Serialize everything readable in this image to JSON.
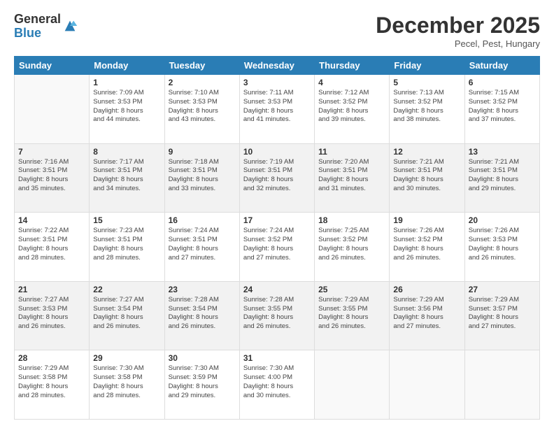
{
  "logo": {
    "general": "General",
    "blue": "Blue"
  },
  "title": "December 2025",
  "subtitle": "Pecel, Pest, Hungary",
  "headers": [
    "Sunday",
    "Monday",
    "Tuesday",
    "Wednesday",
    "Thursday",
    "Friday",
    "Saturday"
  ],
  "weeks": [
    [
      {
        "day": "",
        "info": ""
      },
      {
        "day": "1",
        "info": "Sunrise: 7:09 AM\nSunset: 3:53 PM\nDaylight: 8 hours\nand 44 minutes."
      },
      {
        "day": "2",
        "info": "Sunrise: 7:10 AM\nSunset: 3:53 PM\nDaylight: 8 hours\nand 43 minutes."
      },
      {
        "day": "3",
        "info": "Sunrise: 7:11 AM\nSunset: 3:53 PM\nDaylight: 8 hours\nand 41 minutes."
      },
      {
        "day": "4",
        "info": "Sunrise: 7:12 AM\nSunset: 3:52 PM\nDaylight: 8 hours\nand 39 minutes."
      },
      {
        "day": "5",
        "info": "Sunrise: 7:13 AM\nSunset: 3:52 PM\nDaylight: 8 hours\nand 38 minutes."
      },
      {
        "day": "6",
        "info": "Sunrise: 7:15 AM\nSunset: 3:52 PM\nDaylight: 8 hours\nand 37 minutes."
      }
    ],
    [
      {
        "day": "7",
        "info": "Sunrise: 7:16 AM\nSunset: 3:51 PM\nDaylight: 8 hours\nand 35 minutes."
      },
      {
        "day": "8",
        "info": "Sunrise: 7:17 AM\nSunset: 3:51 PM\nDaylight: 8 hours\nand 34 minutes."
      },
      {
        "day": "9",
        "info": "Sunrise: 7:18 AM\nSunset: 3:51 PM\nDaylight: 8 hours\nand 33 minutes."
      },
      {
        "day": "10",
        "info": "Sunrise: 7:19 AM\nSunset: 3:51 PM\nDaylight: 8 hours\nand 32 minutes."
      },
      {
        "day": "11",
        "info": "Sunrise: 7:20 AM\nSunset: 3:51 PM\nDaylight: 8 hours\nand 31 minutes."
      },
      {
        "day": "12",
        "info": "Sunrise: 7:21 AM\nSunset: 3:51 PM\nDaylight: 8 hours\nand 30 minutes."
      },
      {
        "day": "13",
        "info": "Sunrise: 7:21 AM\nSunset: 3:51 PM\nDaylight: 8 hours\nand 29 minutes."
      }
    ],
    [
      {
        "day": "14",
        "info": "Sunrise: 7:22 AM\nSunset: 3:51 PM\nDaylight: 8 hours\nand 28 minutes."
      },
      {
        "day": "15",
        "info": "Sunrise: 7:23 AM\nSunset: 3:51 PM\nDaylight: 8 hours\nand 28 minutes."
      },
      {
        "day": "16",
        "info": "Sunrise: 7:24 AM\nSunset: 3:51 PM\nDaylight: 8 hours\nand 27 minutes."
      },
      {
        "day": "17",
        "info": "Sunrise: 7:24 AM\nSunset: 3:52 PM\nDaylight: 8 hours\nand 27 minutes."
      },
      {
        "day": "18",
        "info": "Sunrise: 7:25 AM\nSunset: 3:52 PM\nDaylight: 8 hours\nand 26 minutes."
      },
      {
        "day": "19",
        "info": "Sunrise: 7:26 AM\nSunset: 3:52 PM\nDaylight: 8 hours\nand 26 minutes."
      },
      {
        "day": "20",
        "info": "Sunrise: 7:26 AM\nSunset: 3:53 PM\nDaylight: 8 hours\nand 26 minutes."
      }
    ],
    [
      {
        "day": "21",
        "info": "Sunrise: 7:27 AM\nSunset: 3:53 PM\nDaylight: 8 hours\nand 26 minutes."
      },
      {
        "day": "22",
        "info": "Sunrise: 7:27 AM\nSunset: 3:54 PM\nDaylight: 8 hours\nand 26 minutes."
      },
      {
        "day": "23",
        "info": "Sunrise: 7:28 AM\nSunset: 3:54 PM\nDaylight: 8 hours\nand 26 minutes."
      },
      {
        "day": "24",
        "info": "Sunrise: 7:28 AM\nSunset: 3:55 PM\nDaylight: 8 hours\nand 26 minutes."
      },
      {
        "day": "25",
        "info": "Sunrise: 7:29 AM\nSunset: 3:55 PM\nDaylight: 8 hours\nand 26 minutes."
      },
      {
        "day": "26",
        "info": "Sunrise: 7:29 AM\nSunset: 3:56 PM\nDaylight: 8 hours\nand 27 minutes."
      },
      {
        "day": "27",
        "info": "Sunrise: 7:29 AM\nSunset: 3:57 PM\nDaylight: 8 hours\nand 27 minutes."
      }
    ],
    [
      {
        "day": "28",
        "info": "Sunrise: 7:29 AM\nSunset: 3:58 PM\nDaylight: 8 hours\nand 28 minutes."
      },
      {
        "day": "29",
        "info": "Sunrise: 7:30 AM\nSunset: 3:58 PM\nDaylight: 8 hours\nand 28 minutes."
      },
      {
        "day": "30",
        "info": "Sunrise: 7:30 AM\nSunset: 3:59 PM\nDaylight: 8 hours\nand 29 minutes."
      },
      {
        "day": "31",
        "info": "Sunrise: 7:30 AM\nSunset: 4:00 PM\nDaylight: 8 hours\nand 30 minutes."
      },
      {
        "day": "",
        "info": ""
      },
      {
        "day": "",
        "info": ""
      },
      {
        "day": "",
        "info": ""
      }
    ]
  ]
}
